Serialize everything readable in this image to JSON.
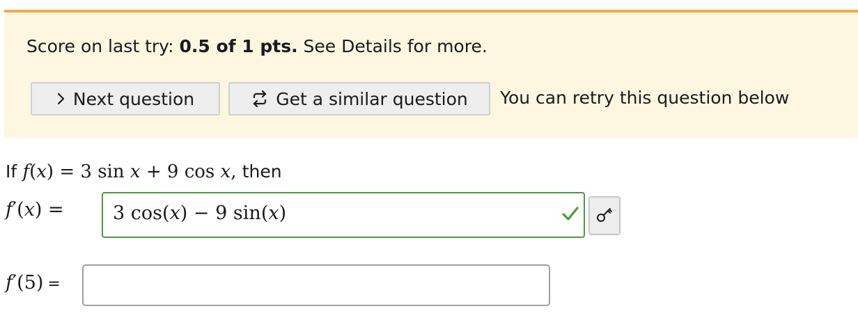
{
  "notice": {
    "score_prefix": "Score on last try: ",
    "score_value": "0.5 of 1 pts.",
    "score_suffix": " See Details for more.",
    "next_button": "Next question",
    "similar_button": "Get a similar question",
    "retry_text": "You can retry this question below"
  },
  "question": {
    "intro_if": "If",
    "f": "f",
    "x": "x",
    "eq": "=",
    "coef1": "3",
    "sin": "sin",
    "plus": "+",
    "coef2": "9",
    "cos": "cos",
    "comma": ",",
    "then": "then",
    "fprime": "f",
    "prime": "′",
    "five": "5"
  },
  "answer1": {
    "coef1": "3",
    "cos": "cos",
    "minus": "−",
    "coef2": "9",
    "sin": "sin",
    "x": "x",
    "status": "correct"
  },
  "answer2": {
    "value": ""
  },
  "colors": {
    "accent_orange": "#f6a94c",
    "notice_bg": "#fdf7e1",
    "correct_green": "#4b9b3c"
  },
  "icons": {
    "next": "chevron-right-icon",
    "similar": "refresh-icon",
    "correct": "checkmark-icon",
    "key": "key-icon"
  }
}
